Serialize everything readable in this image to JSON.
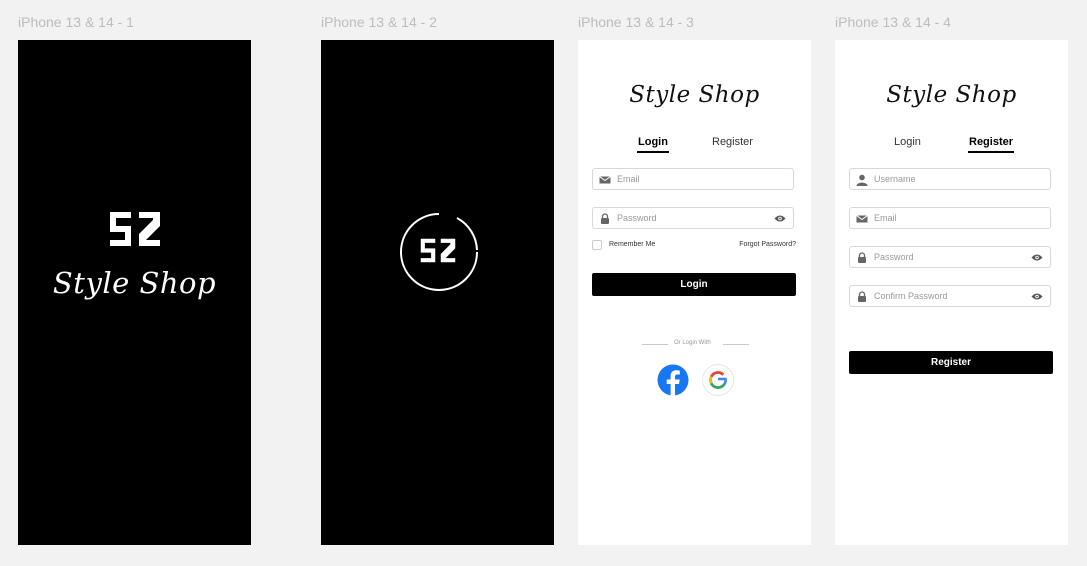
{
  "frames": [
    {
      "label": "iPhone 13 & 14 - 1"
    },
    {
      "label": "iPhone 13 & 14 - 2"
    },
    {
      "label": "iPhone 13 & 14 - 3"
    },
    {
      "label": "iPhone 13 & 14 - 4"
    }
  ],
  "brand": {
    "title": "Style Shop",
    "logo_text": "SZ"
  },
  "login_screen": {
    "tabs": {
      "login": "Login",
      "register": "Register"
    },
    "email_placeholder": "Email",
    "password_placeholder": "Password",
    "remember_label": "Remember Me",
    "forgot_label": "Forgot Password?",
    "submit_label": "Login",
    "or_login_with": "Or Login With"
  },
  "register_screen": {
    "tabs": {
      "login": "Login",
      "register": "Register"
    },
    "username_placeholder": "Username",
    "email_placeholder": "Email",
    "password_placeholder": "Password",
    "confirm_password_placeholder": "Confirm Password",
    "submit_label": "Register"
  },
  "colors": {
    "canvas": "#f2f2f2",
    "primary": "#000000",
    "facebook": "#1877f2",
    "google_blue": "#4285f4",
    "google_red": "#ea4335",
    "google_yellow": "#fbbc05",
    "google_green": "#34a853"
  },
  "icons": [
    "sz-logo-icon",
    "loading-spinner-icon",
    "mail-icon",
    "lock-icon",
    "eye-icon",
    "user-icon",
    "facebook-icon",
    "google-icon"
  ]
}
